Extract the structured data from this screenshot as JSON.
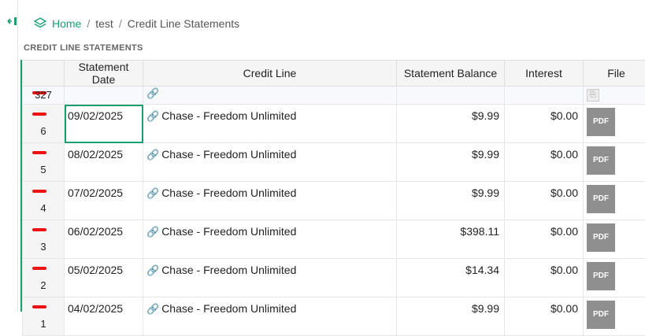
{
  "breadcrumb": {
    "home": "Home",
    "sep1": "/",
    "item1": "test",
    "sep2": "/",
    "item2": "Credit Line Statements"
  },
  "section_title": "CREDIT LINE STATEMENTS",
  "columns": {
    "statement_date": "Statement Date",
    "credit_line": "Credit Line",
    "statement_balance": "Statement Balance",
    "interest": "Interest",
    "file": "File"
  },
  "filter_row": {
    "count": "327"
  },
  "rows": [
    {
      "num": "6",
      "date": "09/02/2025",
      "credit_line": "Chase - Freedom Unlimited",
      "balance": "$9.99",
      "interest": "$0.00",
      "file": "PDF"
    },
    {
      "num": "5",
      "date": "08/02/2025",
      "credit_line": "Chase - Freedom Unlimited",
      "balance": "$9.99",
      "interest": "$0.00",
      "file": "PDF"
    },
    {
      "num": "4",
      "date": "07/02/2025",
      "credit_line": "Chase - Freedom Unlimited",
      "balance": "$9.99",
      "interest": "$0.00",
      "file": "PDF"
    },
    {
      "num": "3",
      "date": "06/02/2025",
      "credit_line": "Chase - Freedom Unlimited",
      "balance": "$398.11",
      "interest": "$0.00",
      "file": "PDF"
    },
    {
      "num": "2",
      "date": "05/02/2025",
      "credit_line": "Chase - Freedom Unlimited",
      "balance": "$14.34",
      "interest": "$0.00",
      "file": "PDF"
    },
    {
      "num": "1",
      "date": "04/02/2025",
      "credit_line": "Chase - Freedom Unlimited",
      "balance": "$9.99",
      "interest": "$0.00",
      "file": "PDF"
    }
  ],
  "colors": {
    "accent": "#1aa06d",
    "pdf_bg": "#8f8f8f",
    "redact": "#e11"
  }
}
